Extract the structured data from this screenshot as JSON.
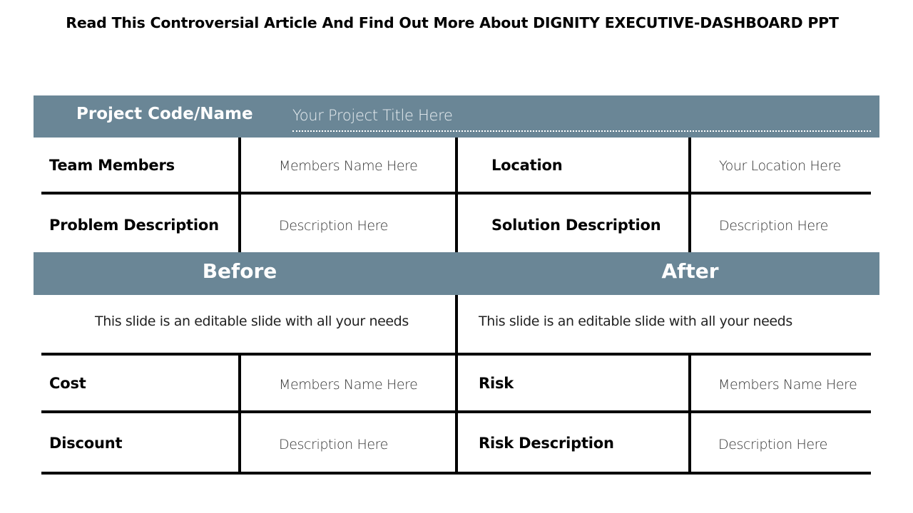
{
  "title": "Read This Controversial Article And Find Out More About DIGNITY EXECUTIVE-DASHBOARD PPT",
  "header": {
    "project_label": "Project Code/Name",
    "project_value": "Your Project Title Here"
  },
  "info_rows": [
    {
      "left_label": "Team Members",
      "left_value": "Members Name Here",
      "right_label": "Location",
      "right_value": "Your Location Here"
    },
    {
      "left_label": "Problem Description",
      "left_value": "Description Here",
      "right_label": "Solution Description",
      "right_value": "Description Here"
    }
  ],
  "sections": {
    "before": {
      "heading": "Before",
      "note": "This slide is an editable slide with all your needs"
    },
    "after": {
      "heading": "After",
      "note": "This slide is an editable slide with all your needs"
    }
  },
  "bottom_rows": [
    {
      "left_label": "Cost",
      "left_value": "Members Name Here",
      "right_label": "Risk",
      "right_value": "Members Name Here"
    },
    {
      "left_label": "Discount",
      "left_value": "Description Here",
      "right_label": "Risk Description",
      "right_value": "Description Here"
    }
  ],
  "colors": {
    "band": "#6a8696",
    "rule": "#000000"
  }
}
